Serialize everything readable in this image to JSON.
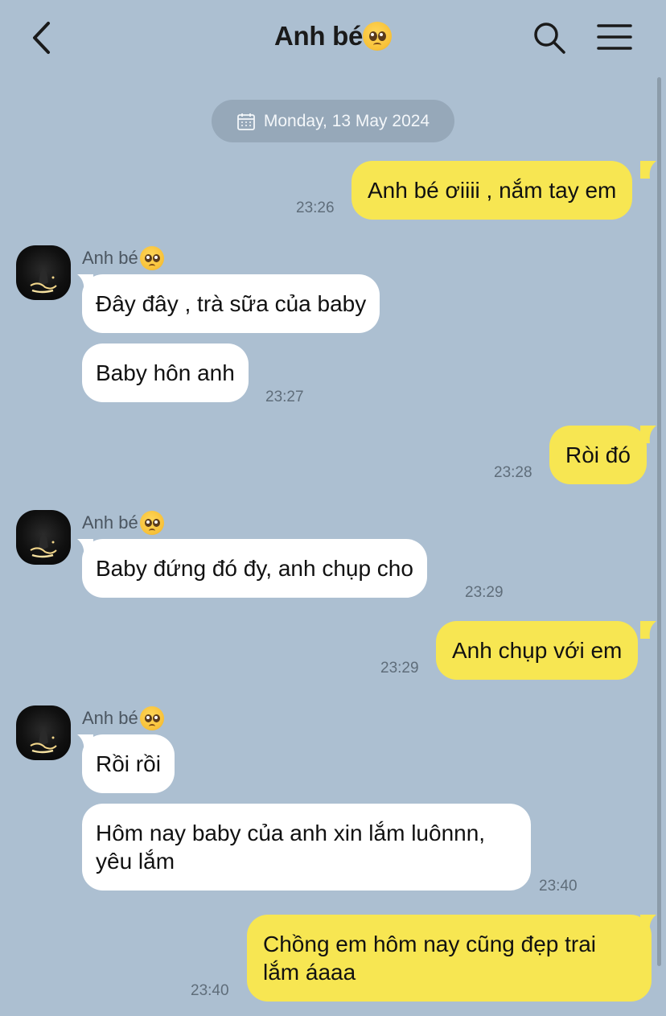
{
  "header": {
    "title": "Anh bé",
    "title_emoji": "pleading-face-emoji"
  },
  "date_divider": "Monday, 13 May 2024",
  "contact": {
    "name": "Anh bé",
    "emoji": "pleading-face-emoji"
  },
  "messages": [
    {
      "dir": "out",
      "text": "Anh bé ơiiii , nắm tay em",
      "time": "23:26"
    },
    {
      "dir": "in",
      "text": "Đây đây , trà sữa của baby"
    },
    {
      "dir": "in",
      "text": "Baby hôn anh",
      "time": "23:27"
    },
    {
      "dir": "out",
      "text": "Ròi đó",
      "time": "23:28"
    },
    {
      "dir": "in",
      "text": "Baby đứng đó đy, anh chụp cho",
      "time": "23:29"
    },
    {
      "dir": "out",
      "text": "Anh chụp với em",
      "time": "23:29"
    },
    {
      "dir": "in",
      "text": "Rồi rồi"
    },
    {
      "dir": "in",
      "line1": "Hôm nay baby của anh xin lắm luônnn,",
      "line2": "yêu lắm",
      "time": "23:40"
    },
    {
      "dir": "out",
      "line1": "Chồng em hôm nay cũng đẹp trai",
      "line2": "lắm áaaa",
      "time": "23:40"
    }
  ],
  "colors": {
    "background": "#acbfd1",
    "incoming_bubble": "#ffffff",
    "outgoing_bubble": "#f7e652",
    "date_pill": "#96a8b9"
  }
}
